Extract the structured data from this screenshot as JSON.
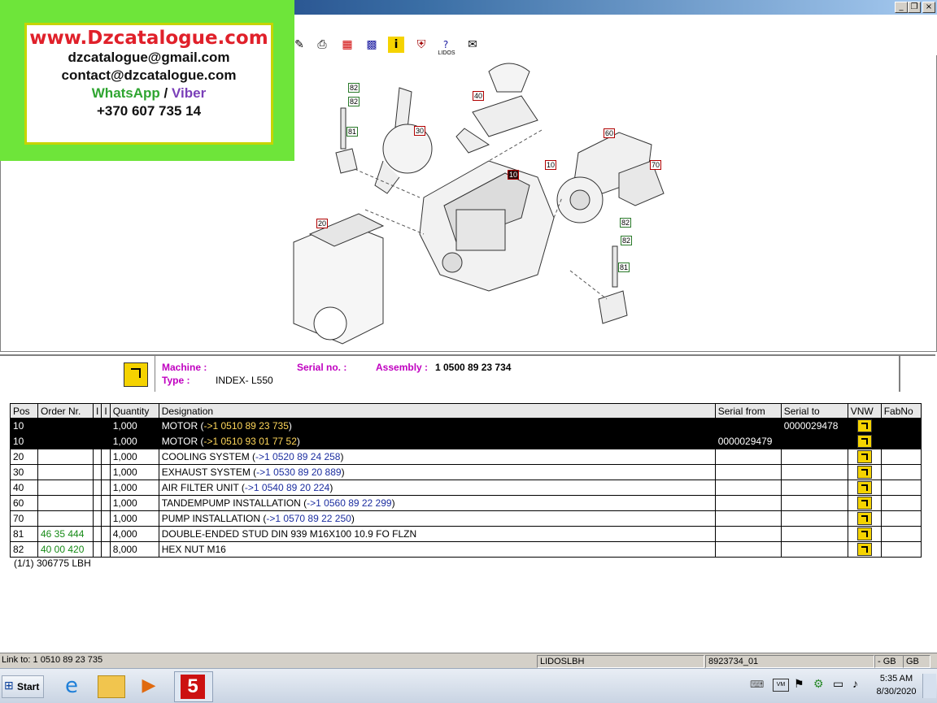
{
  "titlebar": {
    "min": "_",
    "restore": "❐",
    "close": "×"
  },
  "ad": {
    "site": "www.Dzcatalogue.com",
    "email1": "dzcatalogue@gmail.com",
    "email2": "contact@dzcatalogue.com",
    "whatsapp": "WhatsApp",
    "sep": "/",
    "viber": "Viber",
    "phone": "+370 607 735 14"
  },
  "toolbar": {
    "lidos_label": "LIDOS"
  },
  "callouts": [
    {
      "label": "82",
      "style": "green"
    },
    {
      "label": "82",
      "style": "green"
    },
    {
      "label": "81",
      "style": "green"
    },
    {
      "label": "30",
      "style": "red"
    },
    {
      "label": "40",
      "style": "red"
    },
    {
      "label": "10",
      "style": "dark"
    },
    {
      "label": "60",
      "style": "red"
    },
    {
      "label": "10",
      "style": "red"
    },
    {
      "label": "70",
      "style": "red"
    },
    {
      "label": "20",
      "style": "red"
    },
    {
      "label": "82",
      "style": "green"
    },
    {
      "label": "82",
      "style": "green"
    },
    {
      "label": "81",
      "style": "green"
    }
  ],
  "info": {
    "machine_label": "Machine :",
    "type_label": "Type :",
    "type_value": "INDEX- L550",
    "serial_label": "Serial no. :",
    "assembly_label": "Assembly :",
    "assembly_value": "1 0500 89 23 734"
  },
  "table": {
    "headers": [
      "Pos",
      "Order Nr.",
      "I",
      "I",
      "Quantity",
      "Designation",
      "Serial from",
      "Serial to",
      "VNW",
      "FabNo"
    ],
    "rows": [
      {
        "pos": "10",
        "order": "",
        "qty": "1,000",
        "desc": "MOTOR (",
        "ref": "->1 0510 89 23 735",
        "tail": ")",
        "from": "",
        "to": "0000029478",
        "selected": true
      },
      {
        "pos": "10",
        "order": "",
        "qty": "1,000",
        "desc": "MOTOR (",
        "ref": "->1 0510 93 01 77 52",
        "tail": ")",
        "from": "0000029479",
        "to": "",
        "selected": true
      },
      {
        "pos": "20",
        "order": "",
        "qty": "1,000",
        "desc": "COOLING SYSTEM (",
        "ref": "->1 0520 89 24 258",
        "tail": ")",
        "from": "",
        "to": "",
        "selected": false
      },
      {
        "pos": "30",
        "order": "",
        "qty": "1,000",
        "desc": "EXHAUST SYSTEM (",
        "ref": "->1 0530 89 20 889",
        "tail": ")",
        "from": "",
        "to": "",
        "selected": false
      },
      {
        "pos": "40",
        "order": "",
        "qty": "1,000",
        "desc": "AIR FILTER UNIT (",
        "ref": "->1 0540 89 20 224",
        "tail": ")",
        "from": "",
        "to": "",
        "selected": false
      },
      {
        "pos": "60",
        "order": "",
        "qty": "1,000",
        "desc": "TANDEMPUMP INSTALLATION (",
        "ref": "->1 0560 89 22 299",
        "tail": ")",
        "from": "",
        "to": "",
        "selected": false
      },
      {
        "pos": "70",
        "order": "",
        "qty": "1,000",
        "desc": "PUMP INSTALLATION (",
        "ref": "->1 0570 89 22 250",
        "tail": ")",
        "from": "",
        "to": "",
        "selected": false
      },
      {
        "pos": "81",
        "order": "46 35 444",
        "qty": "4,000",
        "desc": "DOUBLE-ENDED STUD DIN 939 M16X100 10.9 FO FLZN",
        "ref": "",
        "tail": "",
        "from": "",
        "to": "",
        "selected": false
      },
      {
        "pos": "82",
        "order": "40 00 420",
        "qty": "8,000",
        "desc": "HEX NUT M16",
        "ref": "",
        "tail": "",
        "from": "",
        "to": "",
        "selected": false
      }
    ],
    "footer": "(1/1) 306775 LBH"
  },
  "status": {
    "link": "Link to: 1 0510 89 23 735",
    "app": "LIDOSLBH",
    "doc": "8923734_01",
    "lang1": "- GB",
    "lang2": "GB"
  },
  "taskbar": {
    "start": "Start",
    "time": "5:35 AM",
    "date": "8/30/2020",
    "tray_vm": "VM"
  }
}
